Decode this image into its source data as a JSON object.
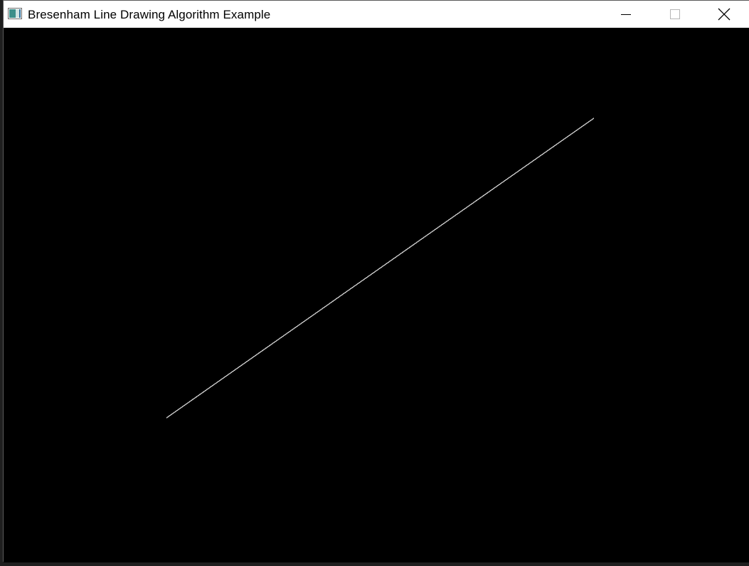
{
  "window": {
    "title": "Bresenham Line Drawing Algorithm Example",
    "app_icon": "window-app-icon",
    "controls": {
      "minimize_icon": "minimize-icon",
      "maximize_icon": "maximize-icon",
      "close_icon": "close-icon"
    }
  },
  "canvas": {
    "background": "#000000",
    "line_color": "#c8c8c8"
  }
}
